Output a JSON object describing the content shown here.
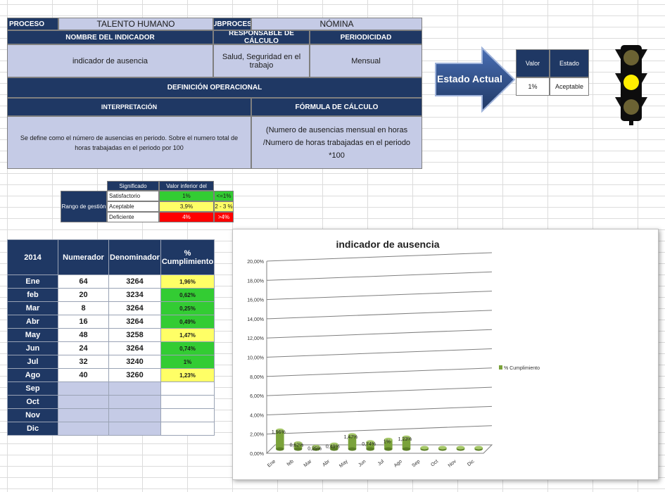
{
  "header": {
    "proceso_label": "PROCESO",
    "proceso_value": "TALENTO HUMANO",
    "subproceso_label": "SUBPROCESO",
    "subproceso_value": "NÓMINA",
    "nombre_label": "NOMBRE DEL INDICADOR",
    "responsable_label": "RESPONSABLE DE CÁLCULO",
    "periodicidad_label": "PERIODICIDAD",
    "nombre_value": "indicador de ausencia",
    "responsable_value": "Salud, Seguridad en el trabajo",
    "periodicidad_value": "Mensual",
    "definicion_label": "DEFINICIÓN OPERACIONAL",
    "interpretacion_label": "INTERPRETACIÓN",
    "formula_label": "FÓRMULA DE CÁLCULO",
    "interpretacion_value": "Se define como el número de ausencias en periodo. Sobre el numero total de horas trabajadas en el periodo  por 100",
    "formula_value": "(Numero de ausencias mensual en horas /Numero de horas trabajadas en el periodo *100"
  },
  "estado": {
    "arrow_label": "Estado Actual",
    "valor_label": "Valor",
    "estado_label": "Estado",
    "valor_value": "1%",
    "estado_value": "Aceptable"
  },
  "rango": {
    "label": "Rango de gestión",
    "significado_label": "Significado",
    "valor_inferior_label": "Valor inferior del",
    "rows": [
      {
        "name": "Satisfactorio",
        "value": "1%",
        "range": "<=1%"
      },
      {
        "name": "Aceptable",
        "value": "3,9%",
        "range": "2 - 3 %"
      },
      {
        "name": "Deficiente",
        "value": "4%",
        "range": ">4%"
      }
    ]
  },
  "table": {
    "year": "2014",
    "numerador_label": "Numerador",
    "denominador_label": "Denominador",
    "cumplimiento_label": "% Cumplimiento",
    "rows": [
      {
        "month": "Ene",
        "num": "64",
        "den": "3264",
        "pct": "1,96%",
        "color": "#ffff66"
      },
      {
        "month": "feb",
        "num": "20",
        "den": "3234",
        "pct": "0,62%",
        "color": "#33cc33"
      },
      {
        "month": "Mar",
        "num": "8",
        "den": "3264",
        "pct": "0,25%",
        "color": "#33cc33"
      },
      {
        "month": "Abr",
        "num": "16",
        "den": "3264",
        "pct": "0,49%",
        "color": "#33cc33"
      },
      {
        "month": "May",
        "num": "48",
        "den": "3258",
        "pct": "1,47%",
        "color": "#ffff66"
      },
      {
        "month": "Jun",
        "num": "24",
        "den": "3264",
        "pct": "0,74%",
        "color": "#33cc33"
      },
      {
        "month": "Jul",
        "num": "32",
        "den": "3240",
        "pct": "1%",
        "color": "#33cc33"
      },
      {
        "month": "Ago",
        "num": "40",
        "den": "3260",
        "pct": "1,23%",
        "color": "#ffff66"
      },
      {
        "month": "Sep",
        "num": "",
        "den": "",
        "pct": "",
        "color": ""
      },
      {
        "month": "Oct",
        "num": "",
        "den": "",
        "pct": "",
        "color": ""
      },
      {
        "month": "Nov",
        "num": "",
        "den": "",
        "pct": "",
        "color": ""
      },
      {
        "month": "Dic",
        "num": "",
        "den": "",
        "pct": "",
        "color": ""
      }
    ]
  },
  "chart_data": {
    "type": "bar",
    "title": "indicador de ausencia",
    "categories": [
      "Ene",
      "feb",
      "Mar",
      "Abr",
      "May",
      "Jun",
      "Jul",
      "Ago",
      "Sep",
      "Oct",
      "Nov",
      "Dic"
    ],
    "series": [
      {
        "name": "% Cumplimiento",
        "values": [
          1.96,
          0.62,
          0.25,
          0.49,
          1.47,
          0.74,
          1.0,
          1.23,
          0,
          0,
          0,
          0
        ]
      }
    ],
    "data_labels": [
      "1,96%",
      "0,62%",
      "0,25%",
      "0,49%",
      "1,47%",
      "0,74%",
      "1%",
      "1,23%",
      "",
      "",
      "",
      ""
    ],
    "yticks": [
      "0,00%",
      "2,00%",
      "4,00%",
      "6,00%",
      "8,00%",
      "10,00%",
      "12,00%",
      "14,00%",
      "16,00%",
      "18,00%",
      "20,00%"
    ],
    "ylim": [
      0,
      20
    ],
    "legend_position": "right",
    "bar_color": "#7aa23a"
  }
}
